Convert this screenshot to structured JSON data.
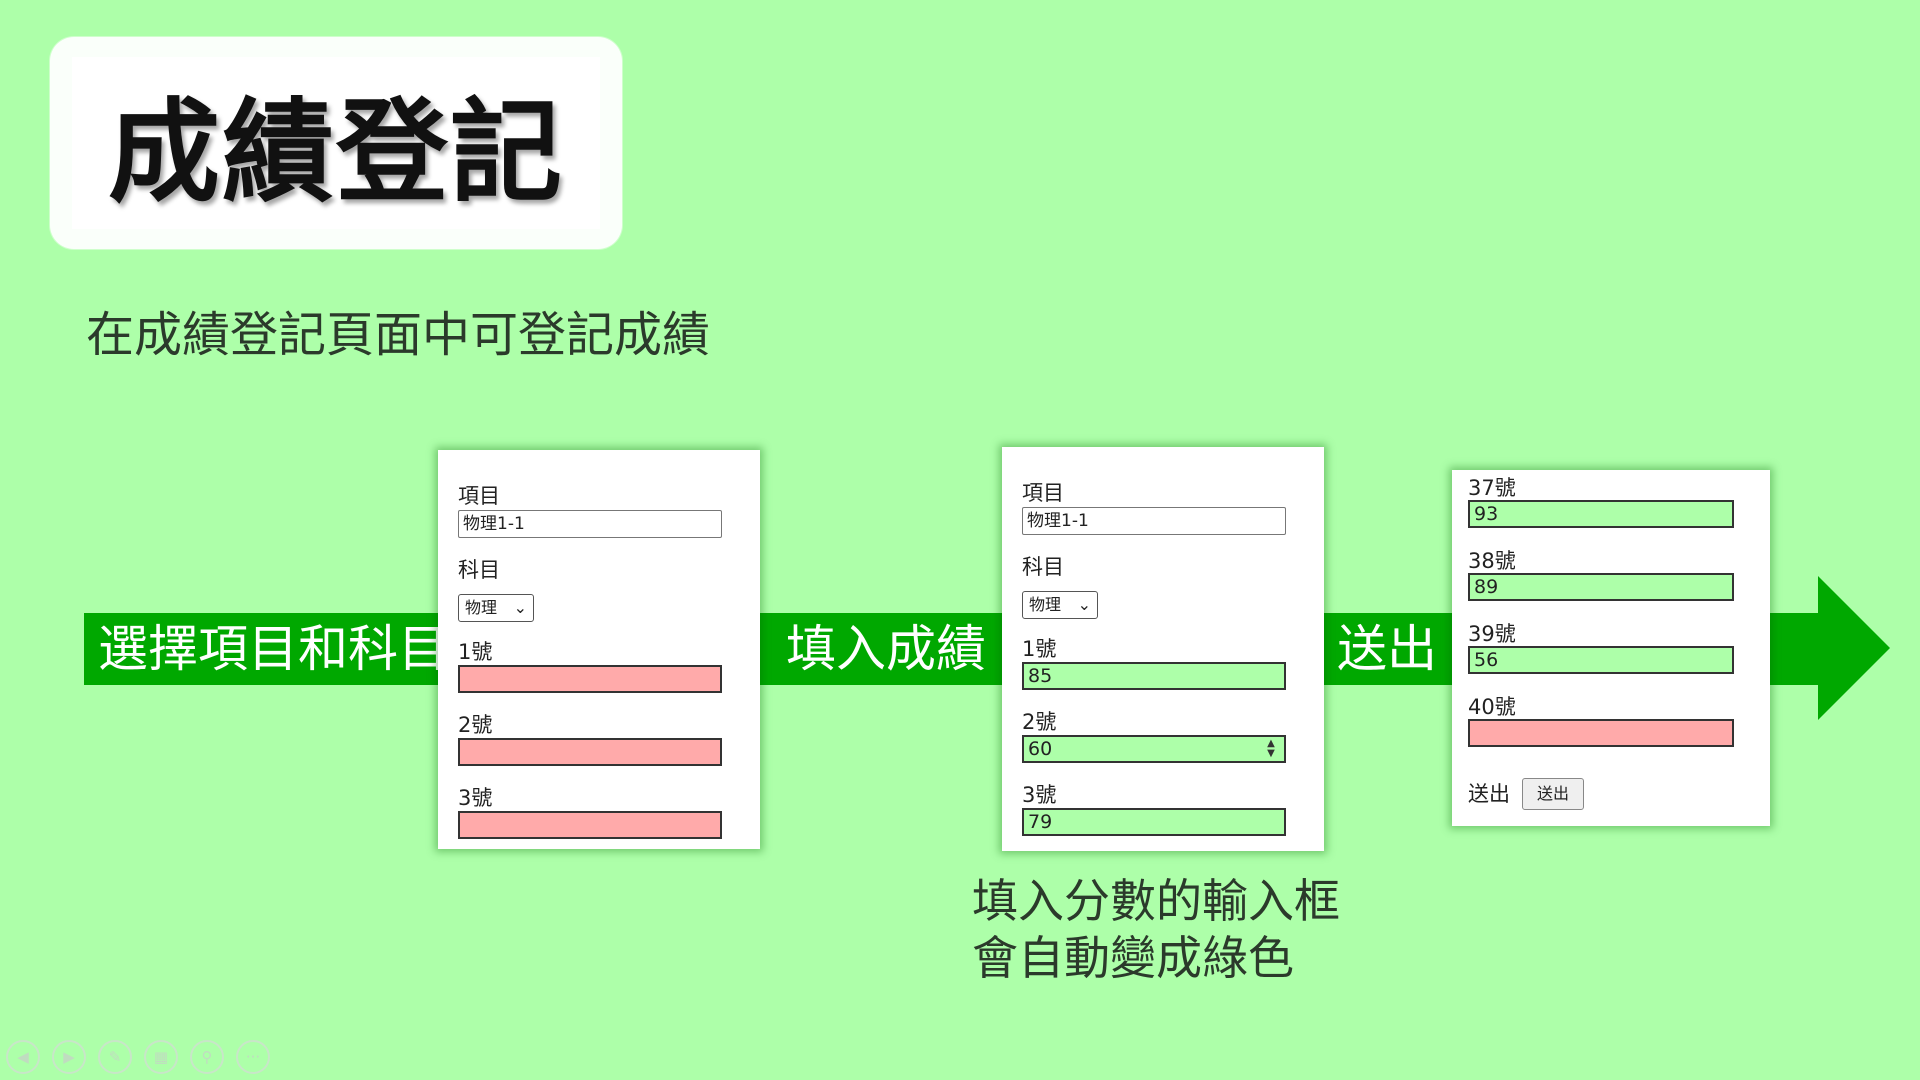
{
  "title": "成績登記",
  "subtitle": "在成績登記頁面中可登記成績",
  "band_labels": {
    "step1": "選擇項目和科目",
    "step2": "填入成績",
    "step3": "送出"
  },
  "caption": {
    "line1": "填入分數的輸入框",
    "line2": "會自動變成綠色"
  },
  "shot1": {
    "item_label": "項目",
    "item_value": "物理1-1",
    "subject_label": "科目",
    "subject_value": "物理",
    "rows": [
      {
        "label": "1號",
        "value": ""
      },
      {
        "label": "2號",
        "value": ""
      },
      {
        "label": "3號",
        "value": ""
      }
    ]
  },
  "shot2": {
    "item_label": "項目",
    "item_value": "物理1-1",
    "subject_label": "科目",
    "subject_value": "物理",
    "rows": [
      {
        "label": "1號",
        "value": "85"
      },
      {
        "label": "2號",
        "value": "60"
      },
      {
        "label": "3號",
        "value": "79"
      }
    ]
  },
  "shot3": {
    "rows": [
      {
        "label": "37號",
        "value": "93"
      },
      {
        "label": "38號",
        "value": "89"
      },
      {
        "label": "39號",
        "value": "56"
      },
      {
        "label": "40號",
        "value": ""
      }
    ],
    "submit_label": "送出",
    "submit_button": "送出"
  },
  "colors": {
    "background": "#adffa9",
    "band": "#00a800",
    "empty_field": "#ffaaaa",
    "filled_field": "#adffa9"
  },
  "nav_icons": [
    "prev-icon",
    "next-icon",
    "pen-icon",
    "slides-icon",
    "zoom-icon",
    "more-icon"
  ]
}
